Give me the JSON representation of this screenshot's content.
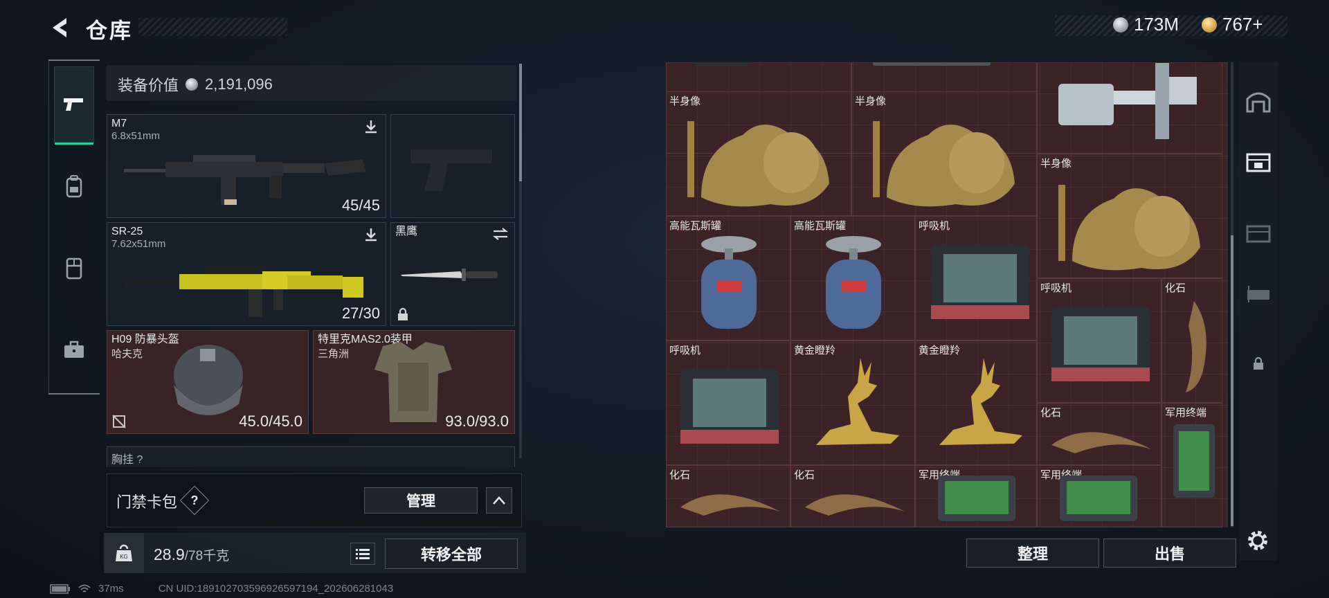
{
  "header": {
    "title": "仓库",
    "currency_silver": "173M",
    "currency_gold": "767+"
  },
  "left_rail": {
    "items": [
      {
        "icon": "pistol-icon",
        "active": true
      },
      {
        "icon": "backpack-icon",
        "active": false
      },
      {
        "icon": "vest-icon",
        "active": false
      },
      {
        "icon": "briefcase-icon",
        "active": false
      }
    ]
  },
  "equipment": {
    "value_label": "装备价值",
    "value": "2,191,096",
    "primary_weapon": {
      "name": "M7",
      "caliber": "6.8x51mm",
      "ammo": "45/45"
    },
    "secondary_weapon": {
      "name": "SR-25",
      "caliber": "7.62x51mm",
      "ammo": "27/30"
    },
    "melee": {
      "name": "黑鹰"
    },
    "helmet": {
      "name": "H09 防暴头盔",
      "brand": "哈夫克",
      "durability": "45.0/45.0"
    },
    "armor": {
      "name": "特里克MAS2.0装甲",
      "brand": "三角洲",
      "durability": "93.0/93.0"
    },
    "chest_partial": "胸挂 ?"
  },
  "access_card": {
    "label": "门禁卡包",
    "help": "?",
    "manage_label": "管理"
  },
  "weight": {
    "current": "28.9",
    "max": "/78千克",
    "transfer_label": "转移全部"
  },
  "status": {
    "ping": "37ms",
    "uid": "CN UID:189102703596926597194_202606281043"
  },
  "storage": {
    "items": [
      {
        "name": "半身像"
      },
      {
        "name": "半身像"
      },
      {
        "name": "半身像"
      },
      {
        "name": "高能瓦斯罐"
      },
      {
        "name": "高能瓦斯罐"
      },
      {
        "name": "呼吸机"
      },
      {
        "name": "呼吸机"
      },
      {
        "name": "化石"
      },
      {
        "name": "呼吸机"
      },
      {
        "name": "黄金瞪羚"
      },
      {
        "name": "黄金瞪羚"
      },
      {
        "name": "化石"
      },
      {
        "name": "军用终端"
      },
      {
        "name": "化石"
      },
      {
        "name": "化石"
      },
      {
        "name": "军用终端"
      },
      {
        "name": "军用终端"
      }
    ],
    "sort_label": "整理",
    "sell_label": "出售"
  },
  "colors": {
    "accent": "#1fd0a8",
    "storage_bg": "#3b2327",
    "slot_red": "#3a2326"
  }
}
